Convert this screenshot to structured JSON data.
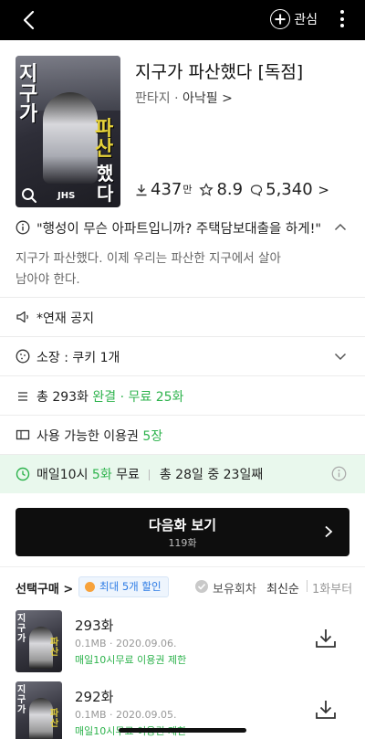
{
  "topbar": {
    "back_icon": "chevron-left-icon",
    "favorite_label": "관심",
    "more_icon": "kebab-menu-icon"
  },
  "cover": {
    "title_part1": "지구가",
    "title_part2": "파산",
    "title_part3": "했다",
    "publisher_mark": "JHS"
  },
  "series": {
    "title": "지구가 파산했다 [독점]",
    "genre": "판타지",
    "separator": "·",
    "author": "아낙필",
    "author_chevron": ">",
    "downloads": "437",
    "downloads_unit": "만",
    "rating": "8.9",
    "comments": "5,340",
    "comments_chevron": ">"
  },
  "summary": {
    "quote": "\"행성이 무슨 아파트입니까? 주택담보대출을 하게!\"",
    "description": "지구가 파산했다. 이제 우리는 파산한 지구에서 살아남아야 한다."
  },
  "rows": {
    "notice": "*연재 공지",
    "owned": "소장 : 쿠키 1개",
    "total_prefix": "총 293화",
    "completed": "완결",
    "dot": "·",
    "free_count": "무료 25화",
    "ticket_prefix": "사용 가능한 이용권",
    "ticket_count": "5장",
    "free_daily_prefix": "매일10시",
    "free_daily_count": "5화",
    "free_daily_suffix": "무료",
    "free_progress": "총 28일 중 23일째"
  },
  "next_button": {
    "label": "다음화 보기",
    "episode": "119화"
  },
  "list_header": {
    "select_buy": "선택구매 >",
    "discount_badge": "최대 5개 할인",
    "owned_episodes": "보유회차",
    "sort_latest": "최신순",
    "from_first": "1화부터"
  },
  "episodes": [
    {
      "number": "293화",
      "info": "0.1MB · 2020.09.06.",
      "limit": "매일10시무료 이용권 제한"
    },
    {
      "number": "292화",
      "info": "0.1MB · 2020.09.05.",
      "limit": "매일10시무료 이용권 제한"
    }
  ],
  "colors": {
    "accent_green": "#2eb34d",
    "free_banner_bg": "#e9f8ed",
    "button_bg": "#0e0e0e",
    "badge_blue": "#2c7be5"
  }
}
